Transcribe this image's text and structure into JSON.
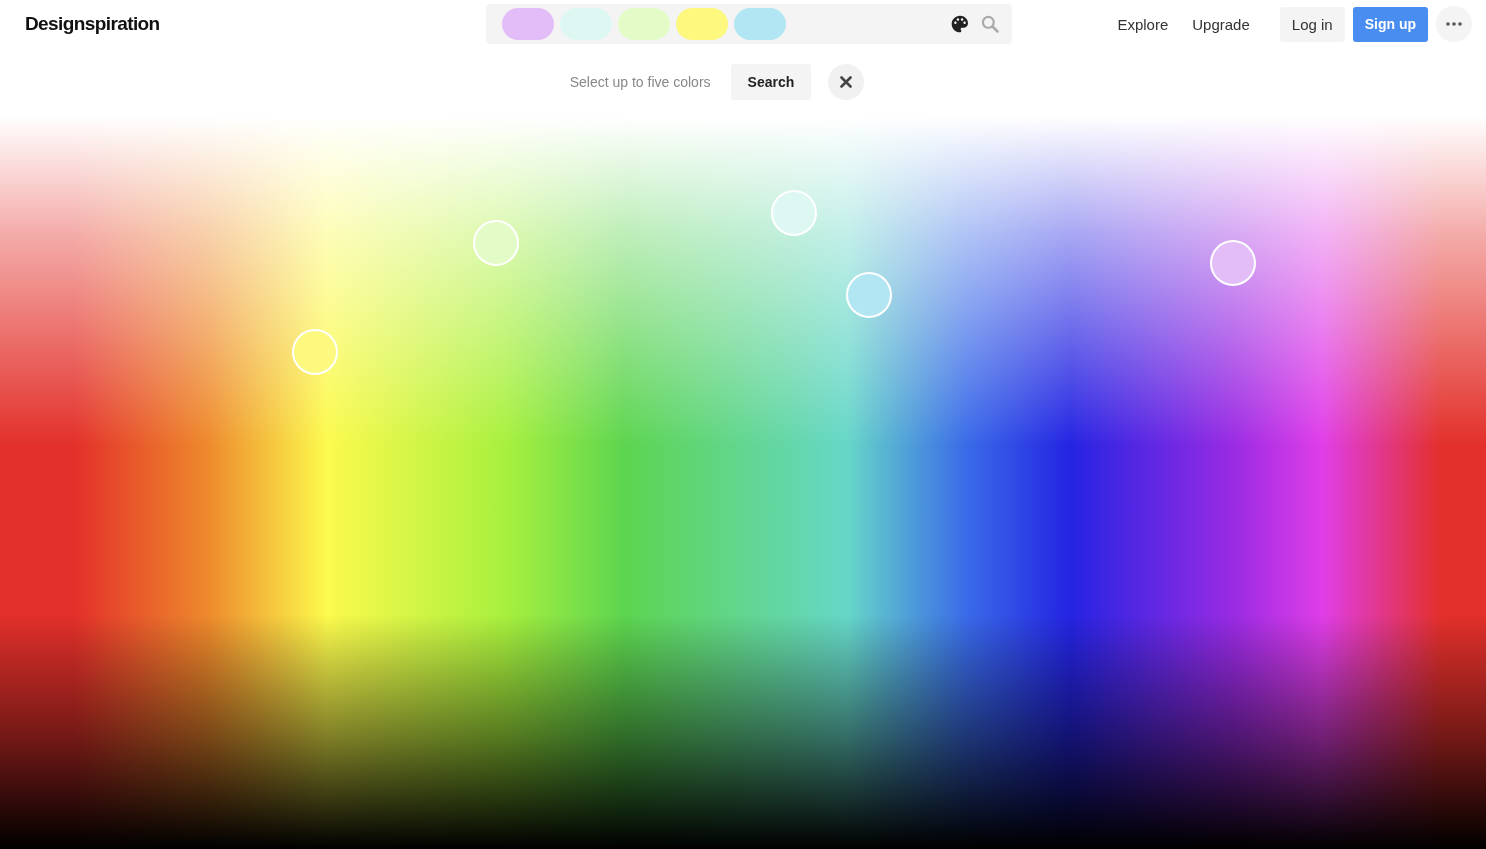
{
  "logo": "Designspiration",
  "search_bar": {
    "swatches": [
      {
        "color": "#e2bdf8"
      },
      {
        "color": "#ddf7f3"
      },
      {
        "color": "#e3fbc7"
      },
      {
        "color": "#fdf87e"
      },
      {
        "color": "#b2e6f2"
      }
    ]
  },
  "nav": {
    "links": [
      "Explore",
      "Upgrade"
    ],
    "login": "Log in",
    "signup": "Sign up"
  },
  "picker": {
    "hint": "Select up to five colors",
    "search": "Search"
  }
}
